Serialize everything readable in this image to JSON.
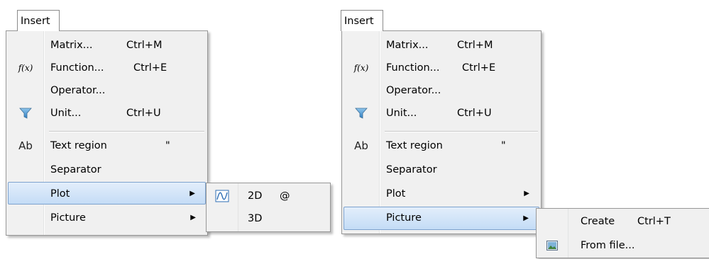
{
  "left": {
    "menubar_label": "Insert",
    "items": {
      "matrix": {
        "label": "Matrix...",
        "shortcut": "Ctrl+M"
      },
      "function": {
        "icon_text": "f(x)",
        "label": "Function...",
        "shortcut": "Ctrl+E"
      },
      "operator": {
        "label": "Operator..."
      },
      "unit": {
        "label": "Unit...",
        "shortcut": "Ctrl+U"
      },
      "text_region": {
        "icon_text": "Ab",
        "label": "Text region",
        "shortcut": "\""
      },
      "separator": {
        "label": "Separator"
      },
      "plot": {
        "label": "Plot",
        "arrow": "▶"
      },
      "picture": {
        "label": "Picture",
        "arrow": "▶"
      }
    },
    "submenu": {
      "items": [
        {
          "label": "2D",
          "shortcut": "@"
        },
        {
          "label": "3D"
        }
      ]
    }
  },
  "right": {
    "menubar_label": "Insert",
    "items": {
      "matrix": {
        "label": "Matrix...",
        "shortcut": "Ctrl+M"
      },
      "function": {
        "icon_text": "f(x)",
        "label": "Function...",
        "shortcut": "Ctrl+E"
      },
      "operator": {
        "label": "Operator..."
      },
      "unit": {
        "label": "Unit...",
        "shortcut": "Ctrl+U"
      },
      "text_region": {
        "icon_text": "Ab",
        "label": "Text region",
        "shortcut": "\""
      },
      "separator": {
        "label": "Separator"
      },
      "plot": {
        "label": "Plot",
        "arrow": "▶"
      },
      "picture": {
        "label": "Picture",
        "arrow": "▶"
      }
    },
    "submenu": {
      "items": [
        {
          "label": "Create",
          "shortcut": "Ctrl+T"
        },
        {
          "label": "From file..."
        }
      ]
    }
  },
  "icons": {
    "function": "function-icon",
    "unit": "unit-funnel-icon",
    "text_region": "text-region-icon",
    "plot_2d": "plot-2d-icon",
    "picture_from_file": "picture-icon"
  },
  "colors": {
    "highlight_border": "#7da2ce",
    "highlight_top": "#e3eefb",
    "highlight_bottom": "#c4dcf6",
    "menu_bg": "#f0f0f0"
  }
}
